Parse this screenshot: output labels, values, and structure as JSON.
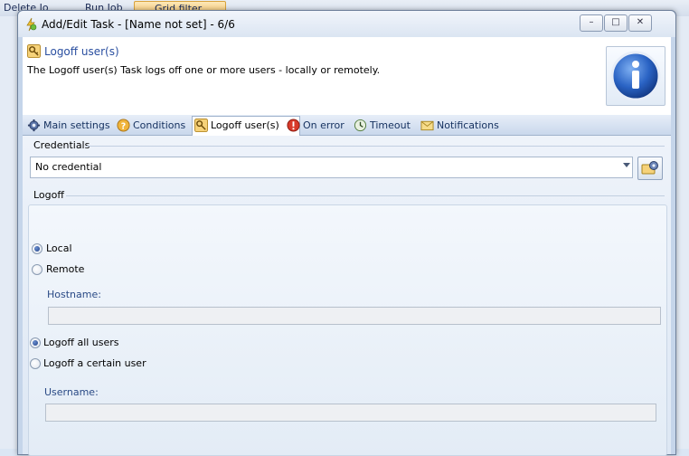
{
  "background": {
    "toolbar_items": [
      "Delete Job",
      "Run Job",
      "Grid filter"
    ]
  },
  "window": {
    "title": "Add/Edit Task - [Name not set] - 6/6",
    "buttons": {
      "minimize": "–",
      "restore": "□",
      "close": "✕"
    }
  },
  "header": {
    "title": "Logoff user(s)",
    "description": "The Logoff user(s) Task logs off one or more users - locally or remotely.",
    "icon": "info-icon"
  },
  "tabs": [
    {
      "label": "Main settings",
      "icon": "gear-icon"
    },
    {
      "label": "Conditions",
      "icon": "question-icon"
    },
    {
      "label": "Logoff user(s)",
      "icon": "key-icon",
      "selected": true
    },
    {
      "label": "On error",
      "icon": "error-icon"
    },
    {
      "label": "Timeout",
      "icon": "timeout-icon"
    },
    {
      "label": "Notifications",
      "icon": "envelope-icon"
    }
  ],
  "credentials": {
    "group_label": "Credentials",
    "selected": "No credential"
  },
  "logoff": {
    "group_label": "Logoff",
    "local_label": "Local",
    "remote_label": "Remote",
    "location_selected": "Local",
    "hostname_label": "Hostname:",
    "hostname_value": "",
    "all_users_label": "Logoff all users",
    "certain_user_label": "Logoff a certain user",
    "user_mode_selected": "Logoff all users",
    "username_label": "Username:",
    "username_value": ""
  },
  "colors": {
    "accent": "#2a4fa0",
    "tab_background": "#c9d8ec",
    "panel_background": "#e3ecf6"
  }
}
